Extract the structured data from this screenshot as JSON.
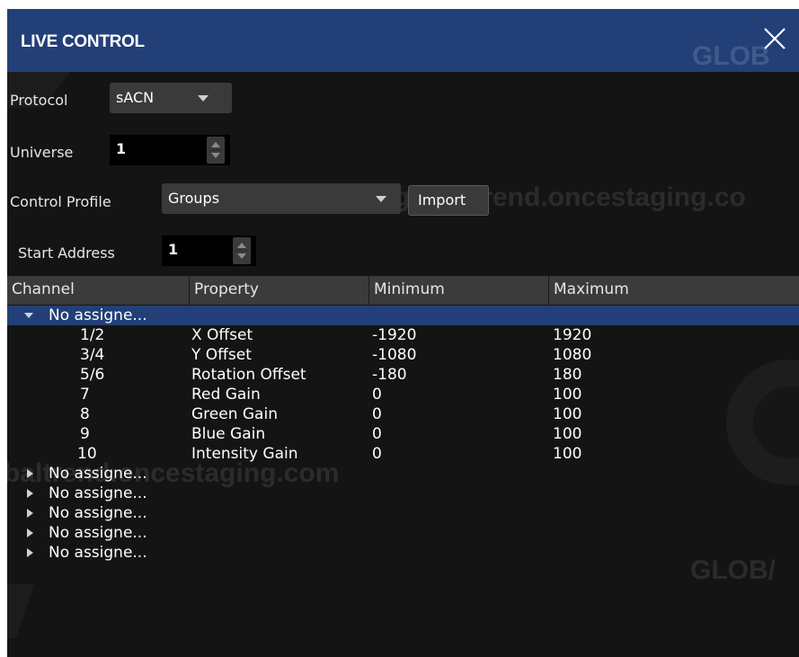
{
  "window": {
    "title": "LIVE CONTROL",
    "close_icon": "close-icon",
    "colors": {
      "titlebar": "#223f78",
      "background": "#141414",
      "selection": "#223f78",
      "header": "#3b3b3b"
    }
  },
  "watermarks": [
    "GLOB",
    "globaltrend.oncestaging.co",
    "GLOBO",
    "baltrend.oncestaging.com",
    "GLOB/"
  ],
  "form": {
    "protocol": {
      "label": "Protocol",
      "value": "sACN"
    },
    "universe": {
      "label": "Universe",
      "value": "1"
    },
    "control_profile": {
      "label": "Control Profile",
      "value": "Groups",
      "import_label": "Import"
    },
    "start_address": {
      "label": "Start Address",
      "value": "1"
    }
  },
  "table": {
    "columns": [
      "Channel",
      "Property",
      "Minimum",
      "Maximum"
    ],
    "expanded_group": {
      "label": "No assigne...",
      "rows": [
        {
          "channel": "1/2",
          "property": "X Offset",
          "minimum": "-1920",
          "maximum": "1920"
        },
        {
          "channel": "3/4",
          "property": "Y Offset",
          "minimum": "-1080",
          "maximum": "1080"
        },
        {
          "channel": "5/6",
          "property": "Rotation Offset",
          "minimum": "-180",
          "maximum": "180"
        },
        {
          "channel": "7",
          "property": "Red Gain",
          "minimum": "0",
          "maximum": "100"
        },
        {
          "channel": "8",
          "property": "Green Gain",
          "minimum": "0",
          "maximum": "100"
        },
        {
          "channel": "9",
          "property": "Blue Gain",
          "minimum": "0",
          "maximum": "100"
        },
        {
          "channel": "10",
          "property": "Intensity Gain",
          "minimum": "0",
          "maximum": "100"
        }
      ]
    },
    "collapsed_groups": [
      "No assigne...",
      "No assigne...",
      "No assigne...",
      "No assigne...",
      "No assigne..."
    ]
  }
}
